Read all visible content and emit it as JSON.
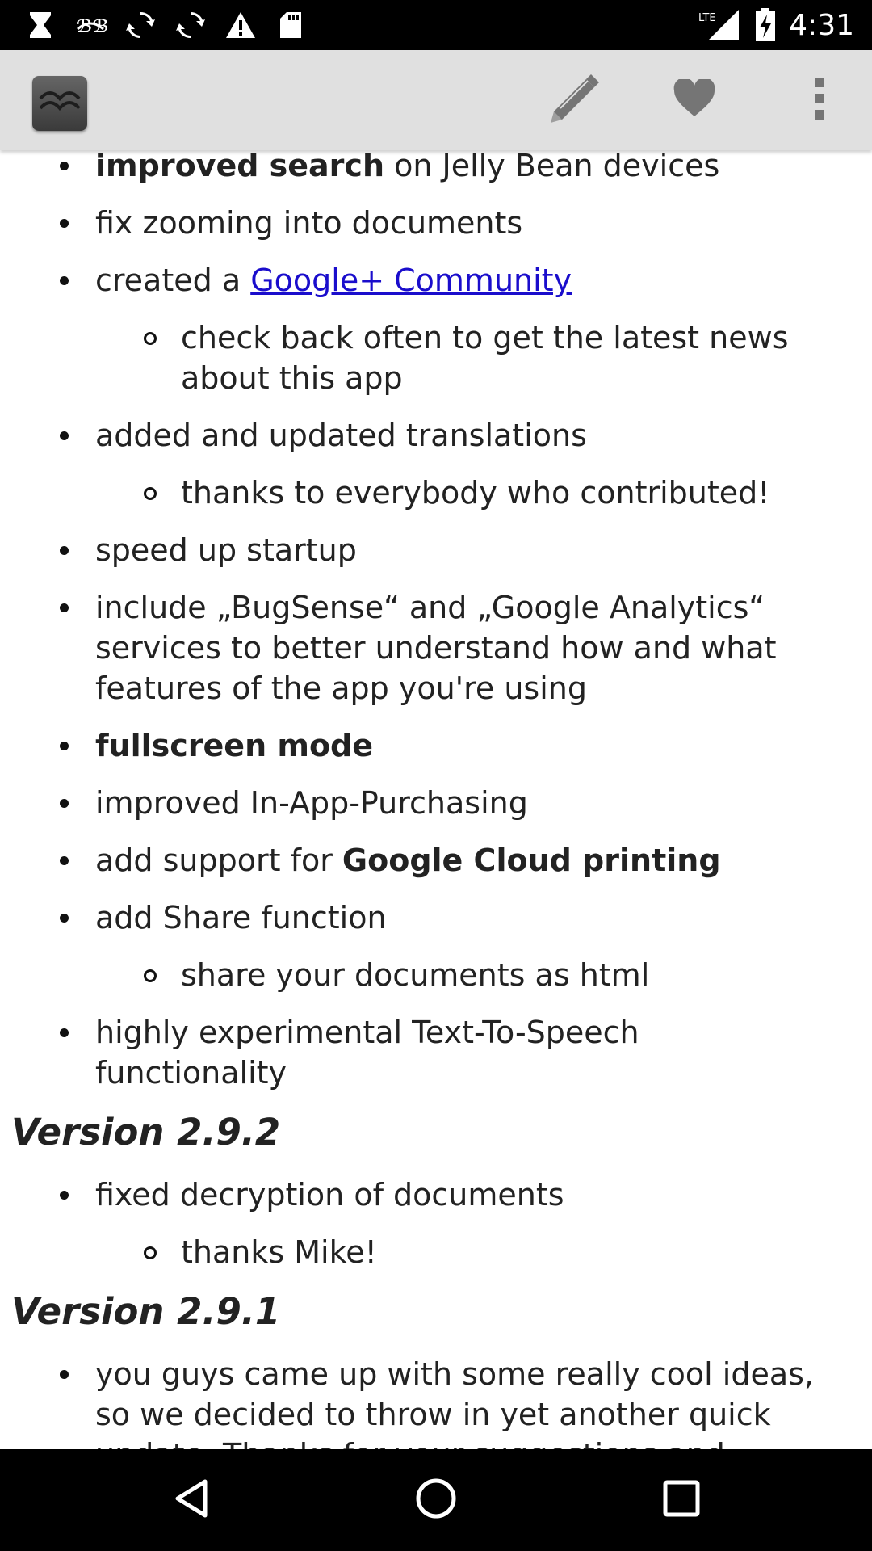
{
  "status_bar": {
    "time": "4:31",
    "network": "LTE",
    "icons": [
      "hourglass-icon",
      "voice-icon",
      "sync-icon",
      "sync-icon",
      "warning-icon",
      "sd-card-icon",
      "signal-icon",
      "battery-charging-icon"
    ]
  },
  "action_bar": {
    "app_icon": "app-icon",
    "actions": [
      "edit-icon",
      "heart-icon",
      "overflow-menu-icon"
    ]
  },
  "changelog": {
    "first_item": {
      "bold": "improved search",
      "rest": " on Jelly Bean devices"
    },
    "items_a": [
      {
        "text": "fix zooming into documents"
      }
    ],
    "community_item": {
      "prefix": "created a ",
      "link": "Google+ Community"
    },
    "community_sub": "check back often to get the latest news about this app",
    "translations_item": "added and updated translations",
    "translations_sub": "thanks to everybody who contributed!",
    "startup_item": "speed up startup",
    "bugsense_item": "include „BugSense“ and „Google Analytics“ services to better understand how and what features of the app you're using",
    "fullscreen_item": "fullscreen mode",
    "iap_item": "improved In-App-Purchasing",
    "print_item": {
      "prefix": "add support for ",
      "bold": "Google Cloud printing"
    },
    "share_item": "add Share function",
    "share_sub": "share your documents as html",
    "tts_item": "highly experimental Text-To-Speech functionality",
    "version_292": "Version 2.9.2",
    "decrypt_item": "fixed decryption of documents",
    "decrypt_sub": "thanks Mike!",
    "version_291": "Version 2.9.1",
    "ideas_item": "you guys came up with some really cool ideas, so we decided to throw in yet another quick update. Thanks for your suggestions and feedback!"
  },
  "nav_bar": {
    "buttons": [
      "back-icon",
      "home-icon",
      "recents-icon"
    ]
  },
  "colors": {
    "link": "#1a0dcc",
    "action_bar": "#e0e0e0",
    "status_bar": "#000000"
  }
}
